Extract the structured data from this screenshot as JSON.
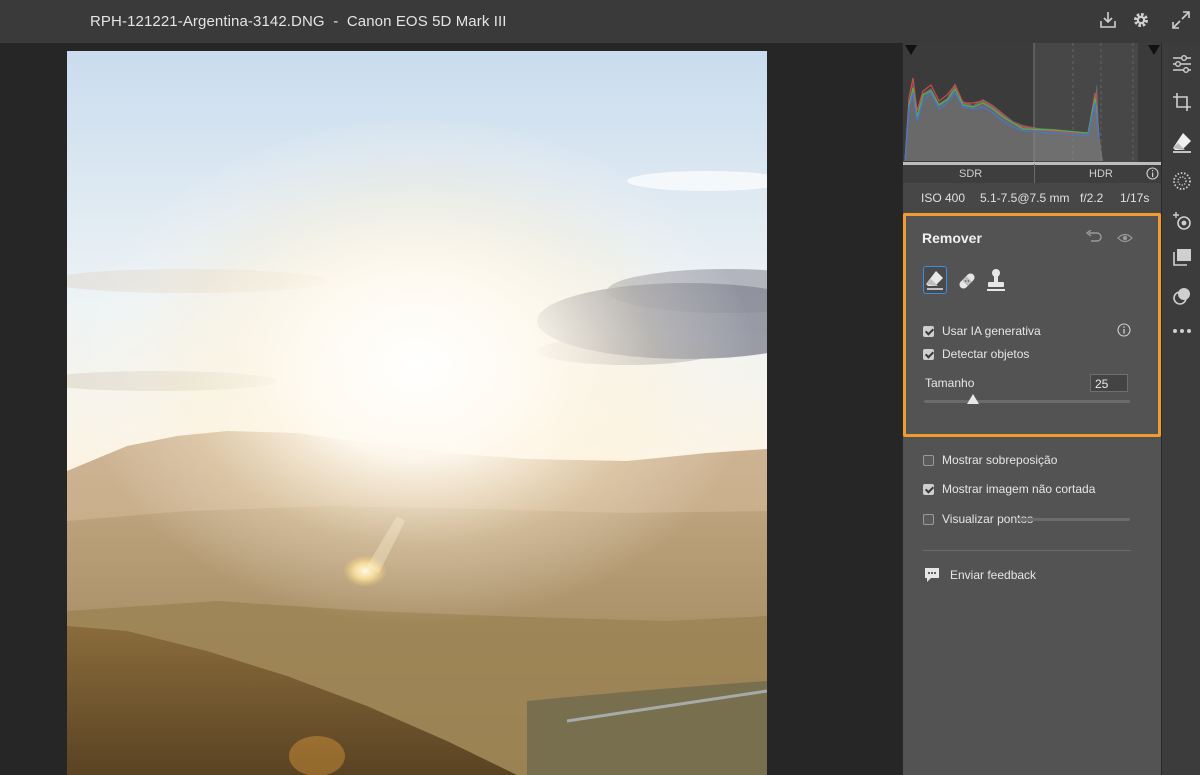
{
  "titlebar": {
    "title": "RPH-121221-Argentina-3142.DNG  -  Canon EOS 5D Mark III",
    "icons": [
      "export-icon",
      "gear-icon",
      "fullscreen-icon"
    ]
  },
  "histogram": {
    "sdr_label": "SDR",
    "hdr_label": "HDR",
    "info_icon": "info-icon"
  },
  "camera_info": {
    "iso": "ISO 400",
    "lens": "5.1-7.5@7.5 mm",
    "aperture": "f/2.2",
    "shutter": "1/17s"
  },
  "remover": {
    "title": "Remover",
    "tools": [
      "eraser-icon",
      "bandage-icon",
      "clone-stamp-icon"
    ],
    "use_gen_ai": {
      "label": "Usar IA generativa",
      "checked": true
    },
    "detect_objects": {
      "label": "Detectar objetos",
      "checked": true
    },
    "size_label": "Tamanho",
    "size_value": "25",
    "size_fraction": 0.24
  },
  "options": {
    "show_overlay": {
      "label": "Mostrar sobreposição",
      "checked": false
    },
    "show_uncropped": {
      "label": "Mostrar imagem não cortada",
      "checked": true
    },
    "visualize_spots": {
      "label": "Visualizar pontos",
      "checked": false
    }
  },
  "feedback": {
    "label": "Enviar feedback"
  },
  "toolstrip": [
    "sliders-icon",
    "crop-icon",
    "eraser-icon",
    "masking-icon",
    "redeye-icon",
    "presets-icon",
    "layers-icon",
    "more-icon"
  ],
  "colors": {
    "accent": "#f29b2e",
    "panel": "#535353",
    "background": "#262626"
  }
}
